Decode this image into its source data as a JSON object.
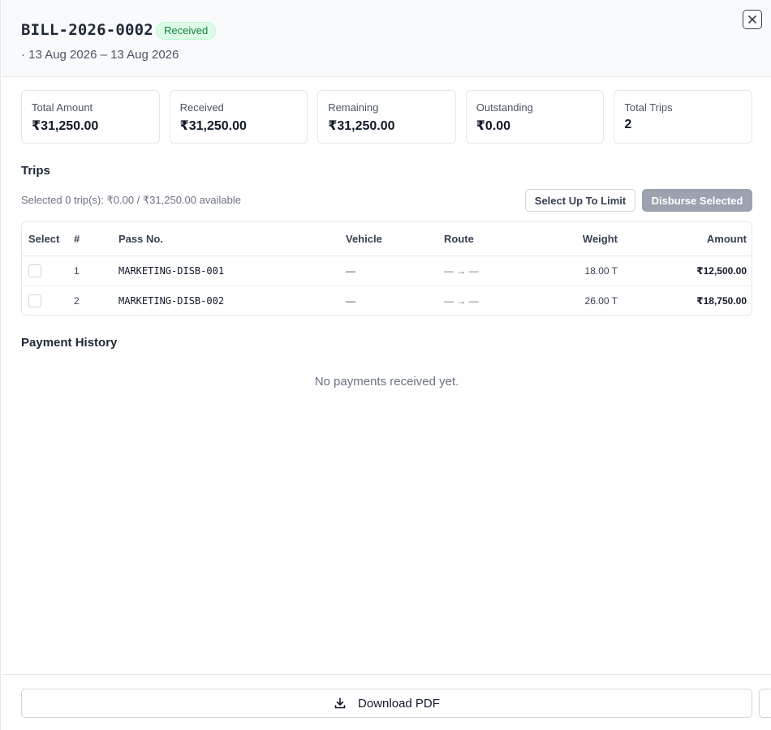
{
  "header": {
    "bill_id": "BILL-2026-0002",
    "status": "Received",
    "date_range": "· 13 Aug 2026 – 13 Aug 2026",
    "close_icon": "close-icon"
  },
  "stats": [
    {
      "label": "Total Amount",
      "value": "₹31,250.00"
    },
    {
      "label": "Received",
      "value": "₹31,250.00"
    },
    {
      "label": "Remaining",
      "value": "₹31,250.00"
    },
    {
      "label": "Outstanding",
      "value": "₹0.00"
    },
    {
      "label": "Total Trips",
      "value": "2"
    }
  ],
  "trips": {
    "title": "Trips",
    "selection_info": "Selected 0 trip(s): ₹0.00 / ₹31,250.00 available",
    "select_limit_label": "Select Up To Limit",
    "disburse_label": "Disburse Selected",
    "columns": [
      "Select",
      "#",
      "Pass No.",
      "Vehicle",
      "Route",
      "Weight",
      "Amount"
    ],
    "rows": [
      {
        "index": "1",
        "pass_no": "MARKETING-DISB-001",
        "vehicle": "—",
        "route": "— → —",
        "weight": "18.00 T",
        "amount": "₹12,500.00"
      },
      {
        "index": "2",
        "pass_no": "MARKETING-DISB-002",
        "vehicle": "—",
        "route": "— → —",
        "weight": "26.00 T",
        "amount": "₹18,750.00"
      }
    ]
  },
  "payment_history": {
    "title": "Payment History",
    "empty_message": "No payments received yet."
  },
  "footer": {
    "download_label": "Download PDF",
    "download_icon": "download-icon"
  },
  "colors": {
    "status_bg": "#dcfce7",
    "status_text": "#15803d",
    "disabled_button": "#9ca3af"
  }
}
